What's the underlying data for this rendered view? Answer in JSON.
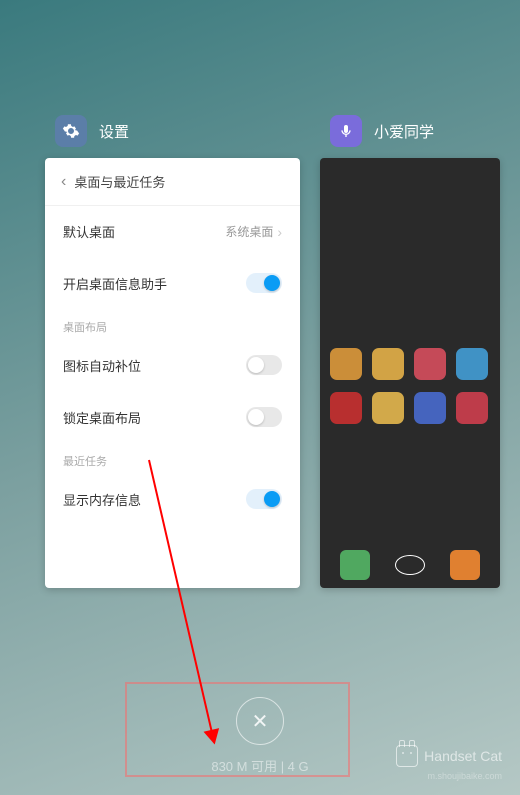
{
  "apps": {
    "settings": {
      "title": "设置"
    },
    "xiaoai": {
      "title": "小爱同学"
    }
  },
  "settings_panel": {
    "header": "桌面与最近任务",
    "default_launcher": {
      "label": "默认桌面",
      "value": "系统桌面"
    },
    "info_assistant": {
      "label": "开启桌面信息助手"
    },
    "section_layout": "桌面布局",
    "auto_fill": {
      "label": "图标自动补位"
    },
    "lock_layout": {
      "label": "锁定桌面布局"
    },
    "section_recent": "最近任务",
    "show_mem": {
      "label": "显示内存信息"
    }
  },
  "memory": {
    "text": "830 M 可用 | 4 G"
  },
  "watermark": {
    "brand": "Handset Cat",
    "url": "m.shoujibaike.com"
  },
  "xiaoai_apps": {
    "colors": [
      "#e8a03c",
      "#f0b94a",
      "#e05060",
      "#44a5e0",
      "#d13030",
      "#f0c050",
      "#4a6fd8",
      "#d84050"
    ]
  },
  "dock": {
    "colors": [
      "#50a860",
      "#3a3a3a",
      "#e08030"
    ]
  }
}
